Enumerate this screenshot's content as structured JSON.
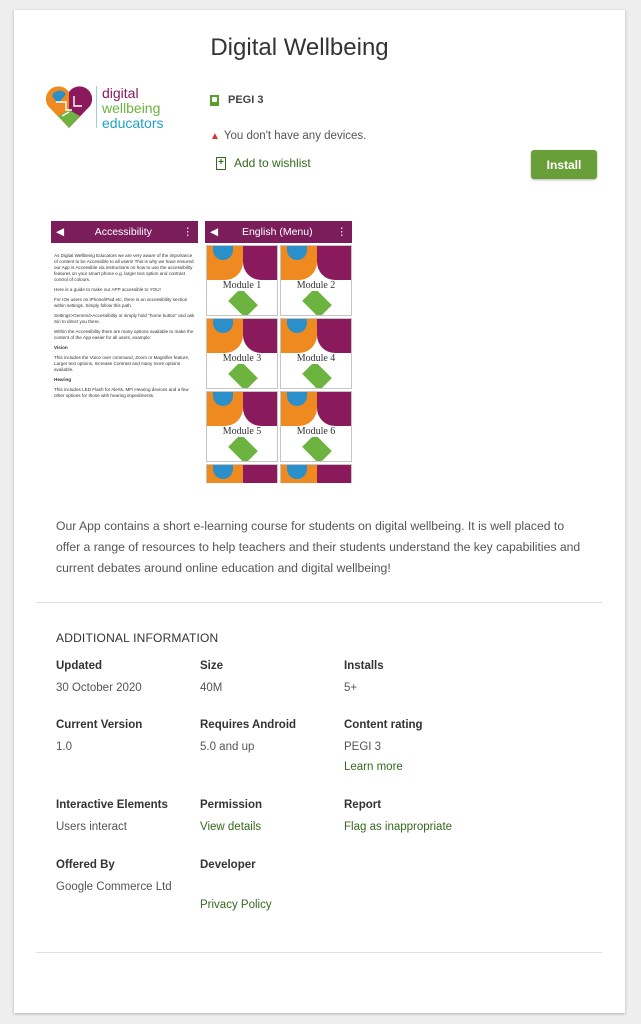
{
  "app": {
    "title": "Digital Wellbeing",
    "logo_lines": [
      "digital",
      "wellbeing",
      "educators"
    ],
    "rating": "PEGI 3",
    "device_warning": "You don't have any devices.",
    "wishlist_label": "Add to wishlist",
    "install_label": "Install"
  },
  "screenshots": {
    "s1": {
      "header": "Accessibility",
      "paragraphs": [
        "As Digital Wellbeing Educators we are very aware of the importance of content to be Accessible to all users! This is why we have ensured our App is Accessible via instructions on how to use the accessibility features on your smart phone e.g. larger text option and contrast control of colours.",
        "Here is a guide to make our APP accessible to YOU!",
        "For IOs users on iPhone/iPad etc, there is an accessibility section within settings. Simply follow this path.",
        "Settings>General>Accessibility or simply hold \"home button\" and ask Siri to direct you there.",
        "Within the Accessibility there are many options available to make the content of the App easier for all users, example:",
        "Vision",
        "This includes the Voice over command, Zoom or Magnifier feature, Larger text options, Increase Contrast and many more options available.",
        "Hearing",
        "This includes LED Flash for Alerts, MFi Hearing devices and a few other options for those with hearing impediments."
      ]
    },
    "s2": {
      "header": "English (Menu)",
      "modules": [
        "Module 1",
        "Module 2",
        "Module 3",
        "Module 4",
        "Module 5",
        "Module 6"
      ]
    }
  },
  "description": "Our App contains a short e-learning course for students on digital wellbeing. It is well placed to offer a range of resources to help teachers and their students understand the key capabilities and current debates around online education and digital wellbeing!",
  "additional": {
    "heading": "ADDITIONAL INFORMATION",
    "updated": {
      "label": "Updated",
      "value": "30 October 2020"
    },
    "size": {
      "label": "Size",
      "value": "40M"
    },
    "installs": {
      "label": "Installs",
      "value": "5+"
    },
    "version": {
      "label": "Current Version",
      "value": "1.0"
    },
    "android": {
      "label": "Requires Android",
      "value": "5.0 and up"
    },
    "content_rating": {
      "label": "Content rating",
      "value": "PEGI 3",
      "link": "Learn more"
    },
    "interactive": {
      "label": "Interactive Elements",
      "value": "Users interact"
    },
    "permission": {
      "label": "Permission",
      "link": "View details"
    },
    "report": {
      "label": "Report",
      "link": "Flag as inappropriate"
    },
    "offered_by": {
      "label": "Offered By",
      "value": "Google Commerce Ltd"
    },
    "developer": {
      "label": "Developer",
      "link": "Privacy Policy"
    }
  },
  "colors": {
    "accent_green": "#689f38",
    "link_green": "#33691e",
    "header_purple": "#7b1d5b",
    "warning_red": "#d93025"
  },
  "icons": [
    "back-arrow-icon",
    "kebab-menu-icon",
    "warning-icon",
    "wishlist-icon",
    "pegi-icon"
  ]
}
